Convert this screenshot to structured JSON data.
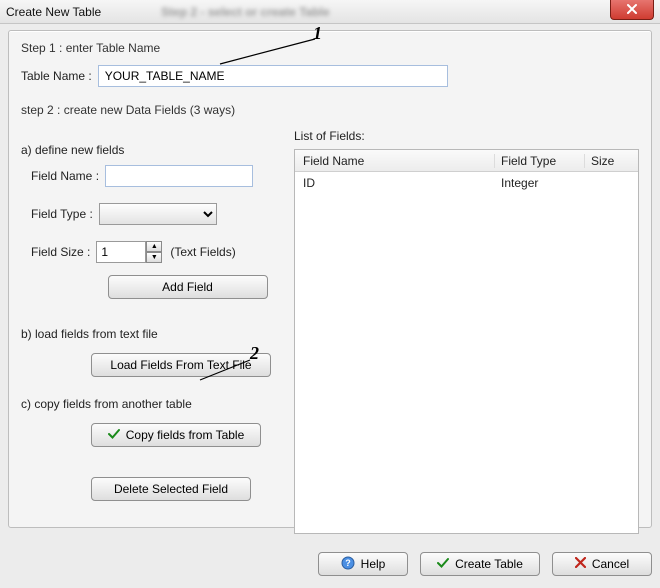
{
  "window": {
    "title": "Create New Table",
    "blurred_background_text": "Step 2 - select or create Table"
  },
  "step1": {
    "heading": "Step 1 : enter Table Name",
    "table_name_label": "Table Name :",
    "table_name_value": "YOUR_TABLE_NAME"
  },
  "step2": {
    "heading": "step 2 : create new Data Fields (3 ways)",
    "sectionA": {
      "heading": "a) define new fields",
      "field_name_label": "Field Name :",
      "field_name_value": "",
      "field_type_label": "Field Type :",
      "field_type_value": "",
      "field_size_label": "Field Size :",
      "field_size_value": "1",
      "field_size_hint": "(Text Fields)",
      "add_field_button": "Add Field"
    },
    "sectionB": {
      "heading": "b) load fields from text file",
      "load_button": "Load Fields From Text File"
    },
    "sectionC": {
      "heading": "c) copy fields from another table",
      "copy_button": "Copy fields from Table"
    },
    "delete_button": "Delete Selected Field",
    "list": {
      "heading": "List of Fields:",
      "columns": {
        "name": "Field Name",
        "type": "Field Type",
        "size": "Size"
      },
      "rows": [
        {
          "name": "ID",
          "type": "Integer",
          "size": ""
        }
      ]
    }
  },
  "buttons": {
    "help": "Help",
    "create": "Create Table",
    "cancel": "Cancel"
  },
  "annotations": {
    "one": "1",
    "two": "2"
  },
  "icons": {
    "close": "close-icon",
    "help": "help-icon",
    "check": "check-icon",
    "cancel": "cross-icon",
    "spin_up": "spin-up-icon",
    "spin_down": "spin-down-icon",
    "dropdown": "dropdown-icon"
  }
}
